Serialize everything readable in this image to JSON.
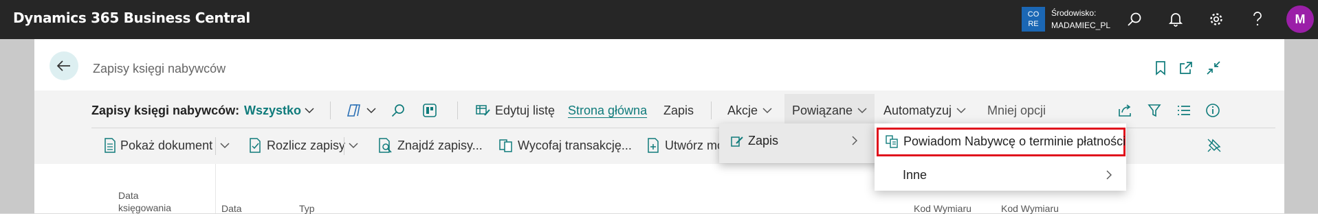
{
  "header": {
    "app_title": "Dynamics 365 Business Central",
    "env_badge_line1": "CO",
    "env_badge_line2": "RE",
    "env_label": "Środowisko:",
    "env_name": "MADAMIEC_PL",
    "avatar_initial": "M"
  },
  "page": {
    "title": "Zapisy księgi nabywców"
  },
  "actionbar": {
    "view_caption": "Zapisy księgi nabywców:",
    "view_filter": "Wszystko",
    "edit_list": "Edytuj listę",
    "home": "Strona główna",
    "posting": "Zapis",
    "actions": "Akcje",
    "related": "Powiązane",
    "automate": "Automatyzuj",
    "fewer_options": "Mniej opcji"
  },
  "toolbar": {
    "show_document": "Pokaż dokument",
    "apply_entries": "Rozlicz zapisy",
    "find_entries": "Znajdź zapisy...",
    "reverse_transaction": "Wycofaj transakcję...",
    "create": "Utwórz mo"
  },
  "columns": {
    "posting_date_1": "Data",
    "posting_date_2": "księgowania",
    "date": "Data",
    "type": "Typ",
    "dim1": "Kod Wymiaru",
    "dim2": "Kod Wymiaru"
  },
  "menu": {
    "entry": "Zapis",
    "notify_customer": "Powiadom Nabywcę o terminie płatności",
    "other": "Inne"
  },
  "colors": {
    "topbar": "#262626",
    "accent": "#0f7b7b",
    "highlight_border": "#e0101c",
    "avatar": "#9b1fa8",
    "env_badge": "#1b67b4"
  }
}
